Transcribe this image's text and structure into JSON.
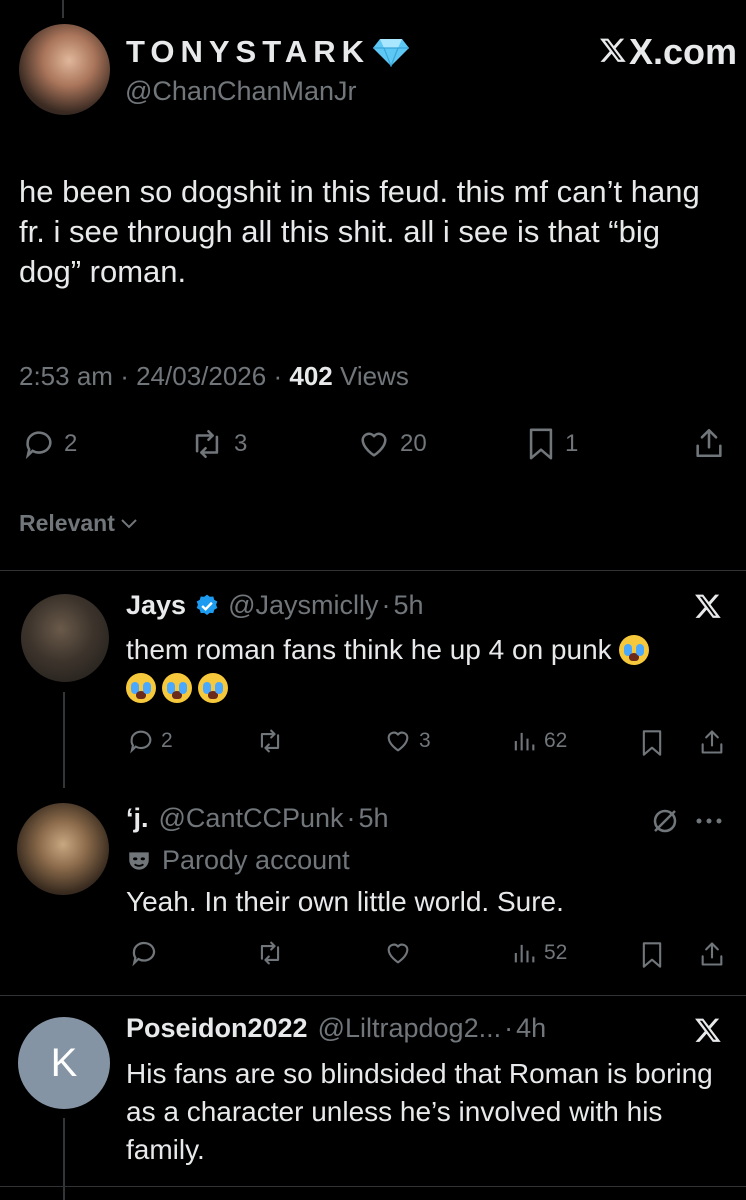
{
  "main_tweet": {
    "display_name": "TONYSTARK",
    "handle": "@ChanChanManJr",
    "source_label": "X.com",
    "text": "he been so dogshit in this feud. this mf can’t hang fr. i see through all this shit. all i see is that “big dog” roman.",
    "time": "2:53 am",
    "date": "24/03/2026",
    "views_count": "402",
    "views_label": "Views",
    "sep": "·",
    "stats": {
      "replies": "2",
      "reposts": "3",
      "likes": "20",
      "bookmarks": "1"
    }
  },
  "sort": {
    "label": "Relevant"
  },
  "replies": [
    {
      "name": "Jays",
      "handle": "@Jaysmiclly",
      "time": "5h",
      "text": "them roman fans think he up 4 on punk",
      "stats": {
        "replies": "2",
        "reposts": "",
        "likes": "3",
        "views": "62"
      }
    },
    {
      "name": "‘j.",
      "handle": "@CantCCPunk",
      "time": "5h",
      "badge": "Parody account",
      "text": "Yeah. In their own little world. Sure.",
      "stats": {
        "replies": "",
        "reposts": "",
        "likes": "",
        "views": "52"
      }
    },
    {
      "name": "Poseidon2022",
      "handle": "@Liltrapdog2...",
      "time": "4h",
      "avatar_letter": "K",
      "text": "His fans are so blindsided that Roman is boring as a character unless he’s involved with his family."
    }
  ],
  "colors": {
    "verified": "#1d9bf0",
    "diamond": "#5ec8f5",
    "muted": "#71767b"
  }
}
